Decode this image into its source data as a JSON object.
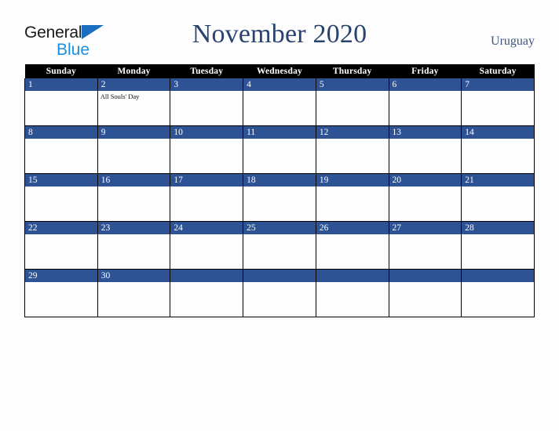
{
  "brand": {
    "word1": "General",
    "word2": "Blue",
    "triangle_color": "#1a6dbf",
    "word1_color": "#1a1a1a",
    "word2_color": "#1a8fe0"
  },
  "header": {
    "title": "November 2020",
    "country": "Uruguay",
    "title_color": "#29436e",
    "country_color": "#3d5680"
  },
  "calendar": {
    "accent_color": "#2e5395",
    "header_bg": "#000000",
    "weekday_headers": [
      "Sunday",
      "Monday",
      "Tuesday",
      "Wednesday",
      "Thursday",
      "Friday",
      "Saturday"
    ],
    "weeks": [
      [
        {
          "day": "1",
          "events": []
        },
        {
          "day": "2",
          "events": [
            "All Souls' Day"
          ]
        },
        {
          "day": "3",
          "events": []
        },
        {
          "day": "4",
          "events": []
        },
        {
          "day": "5",
          "events": []
        },
        {
          "day": "6",
          "events": []
        },
        {
          "day": "7",
          "events": []
        }
      ],
      [
        {
          "day": "8",
          "events": []
        },
        {
          "day": "9",
          "events": []
        },
        {
          "day": "10",
          "events": []
        },
        {
          "day": "11",
          "events": []
        },
        {
          "day": "12",
          "events": []
        },
        {
          "day": "13",
          "events": []
        },
        {
          "day": "14",
          "events": []
        }
      ],
      [
        {
          "day": "15",
          "events": []
        },
        {
          "day": "16",
          "events": []
        },
        {
          "day": "17",
          "events": []
        },
        {
          "day": "18",
          "events": []
        },
        {
          "day": "19",
          "events": []
        },
        {
          "day": "20",
          "events": []
        },
        {
          "day": "21",
          "events": []
        }
      ],
      [
        {
          "day": "22",
          "events": []
        },
        {
          "day": "23",
          "events": []
        },
        {
          "day": "24",
          "events": []
        },
        {
          "day": "25",
          "events": []
        },
        {
          "day": "26",
          "events": []
        },
        {
          "day": "27",
          "events": []
        },
        {
          "day": "28",
          "events": []
        }
      ],
      [
        {
          "day": "29",
          "events": []
        },
        {
          "day": "30",
          "events": []
        },
        {
          "day": "",
          "events": []
        },
        {
          "day": "",
          "events": []
        },
        {
          "day": "",
          "events": []
        },
        {
          "day": "",
          "events": []
        },
        {
          "day": "",
          "events": []
        }
      ]
    ]
  }
}
